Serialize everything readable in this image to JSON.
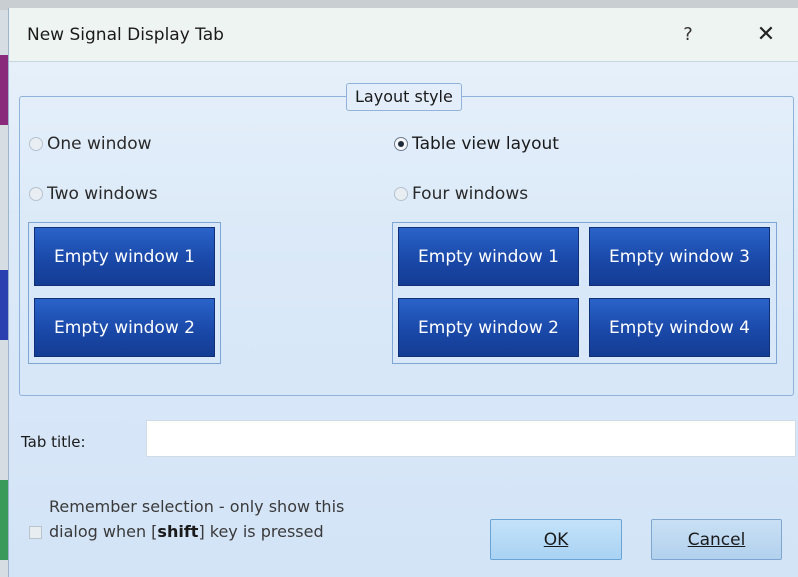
{
  "dialog": {
    "title": "New Signal Display Tab",
    "help_glyph": "?",
    "close_glyph": "✕"
  },
  "layout_style": {
    "legend": "Layout style",
    "options": [
      {
        "label": "One window",
        "checked": false
      },
      {
        "label": "Two windows",
        "checked": false
      },
      {
        "label": "Table view layout",
        "checked": true
      },
      {
        "label": "Four windows",
        "checked": false
      }
    ],
    "two_window_preview": [
      "Empty window 1",
      "Empty window 2"
    ],
    "four_window_preview": [
      "Empty window 1",
      "Empty window 3",
      "Empty window 2",
      "Empty window 4"
    ]
  },
  "tab_title": {
    "label": "Tab title:",
    "value": ""
  },
  "remember": {
    "line1": "Remember selection - only show this",
    "line2_prefix": "dialog when [",
    "line2_key": "shift",
    "line2_suffix": "] key is pressed",
    "checked": false
  },
  "buttons": {
    "ok": "OK",
    "cancel": "Cancel"
  },
  "colors": {
    "window_button": "#1a49a9",
    "ok_button": "#a9d3f3"
  }
}
